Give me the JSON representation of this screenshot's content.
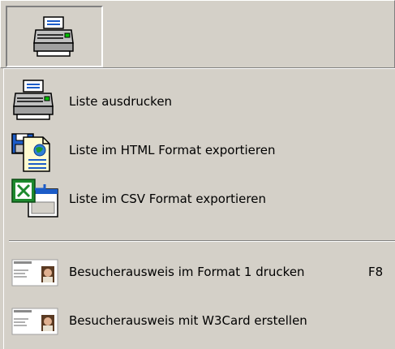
{
  "toolbar": {
    "print_button_icon": "printer-icon"
  },
  "menu": {
    "items": [
      {
        "label": "Liste ausdrucken",
        "icon": "printer-icon",
        "shortcut": ""
      },
      {
        "label": "Liste im HTML Format exportieren",
        "icon": "html-document-icon",
        "shortcut": ""
      },
      {
        "label": "Liste im CSV Format exportieren",
        "icon": "csv-export-icon",
        "shortcut": ""
      },
      {
        "label": "Besucherausweis im Format 1 drucken",
        "icon": "visitor-badge-icon",
        "shortcut": "F8"
      },
      {
        "label": "Besucherausweis mit W3Card erstellen",
        "icon": "visitor-badge-icon",
        "shortcut": ""
      }
    ]
  },
  "colors": {
    "face": "#d4d0c8",
    "shadow": "#808080",
    "highlight": "#ffffff",
    "excel_green": "#1d8a2e",
    "ie_blue": "#1c5cc8"
  }
}
